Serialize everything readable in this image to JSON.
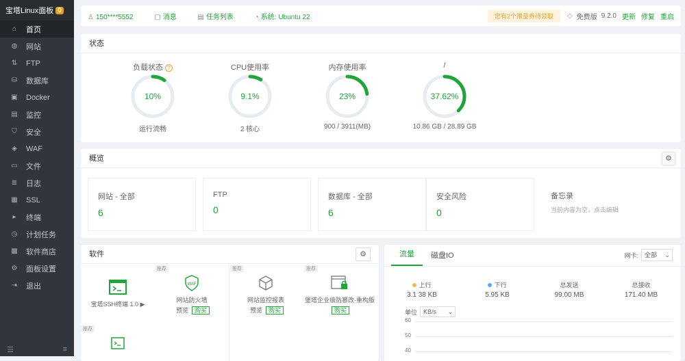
{
  "sidebar": {
    "brand": "宝塔Linux面板",
    "version_badge": "0",
    "items": [
      {
        "icon": "home-icon",
        "glyph": "⌂",
        "label": "首页"
      },
      {
        "icon": "globe-icon",
        "glyph": "◍",
        "label": "网站"
      },
      {
        "icon": "ftp-icon",
        "glyph": "⇅",
        "label": "FTP"
      },
      {
        "icon": "database-icon",
        "glyph": "⛁",
        "label": "数据库"
      },
      {
        "icon": "docker-icon",
        "glyph": "▣",
        "label": "Docker"
      },
      {
        "icon": "monitor-icon",
        "glyph": "▤",
        "label": "监控"
      },
      {
        "icon": "shield-icon",
        "glyph": "⛉",
        "label": "安全"
      },
      {
        "icon": "waf-icon",
        "glyph": "◈",
        "label": "WAF"
      },
      {
        "icon": "folder-icon",
        "glyph": "▭",
        "label": "文件"
      },
      {
        "icon": "log-icon",
        "glyph": "≣",
        "label": "日志"
      },
      {
        "icon": "ssl-icon",
        "glyph": "▦",
        "label": "SSL"
      },
      {
        "icon": "terminal-icon",
        "glyph": "▸",
        "label": "终端"
      },
      {
        "icon": "cron-icon",
        "glyph": "◷",
        "label": "计划任务"
      },
      {
        "icon": "store-icon",
        "glyph": "▩",
        "label": "软件商店"
      },
      {
        "icon": "settings-icon",
        "glyph": "⚙",
        "label": "面板设置"
      },
      {
        "icon": "logout-icon",
        "glyph": "⇥",
        "label": "退出"
      }
    ],
    "active_index": 0
  },
  "topbar": {
    "user": "150****5552",
    "notice": "消息",
    "tasks": "任务列表",
    "system": "系统: Ubuntu 22",
    "promo": "您有2个限量券待领取",
    "edition": "免费版",
    "version": "9.2.0",
    "update": "更新",
    "repair": "修复",
    "restart": "重启"
  },
  "status": {
    "title": "状态",
    "gauges": [
      {
        "label": "负载状态",
        "value": "10%",
        "pct": 10,
        "sub": "运行流畅"
      },
      {
        "label": "CPU使用率",
        "value": "9.1%",
        "pct": 9.1,
        "sub": "2 核心"
      },
      {
        "label": "内存使用率",
        "value": "23%",
        "pct": 23,
        "sub": "900 / 3911(MB)"
      },
      {
        "label": "/",
        "value": "37.62%",
        "pct": 37.62,
        "sub": "10.86 GB / 28.89 GB"
      }
    ]
  },
  "overview": {
    "title": "概览",
    "items": [
      {
        "label": "网站 - 全部",
        "value": "6"
      },
      {
        "label": "FTP",
        "value": "0"
      },
      {
        "label": "数据库 - 全部",
        "value": "6"
      },
      {
        "label": "安全风险",
        "value": "0"
      }
    ],
    "memo_label": "备忘录",
    "memo_hint": "当前内容为空，点击编辑"
  },
  "software": {
    "title": "软件",
    "tag_recommend": "推荐",
    "items": [
      {
        "name": "宝塔SSH终端 1.0 ▶",
        "icon": "terminal-icon"
      },
      {
        "name": "网站防火墙",
        "icon": "waf-shield-icon",
        "act1": "预览",
        "act2": "购买"
      },
      {
        "name": "网站监控报表",
        "icon": "cube-icon",
        "act1": "预览",
        "act2": "购买"
      },
      {
        "name": "堡塔企业级防篡改-重构版",
        "icon": "lock-window-icon",
        "act2": "购买"
      }
    ]
  },
  "traffic": {
    "tabs": [
      "流量",
      "磁盘IO"
    ],
    "iface_label": "网卡:",
    "iface_value": "全部",
    "stats": [
      {
        "key": "上行",
        "value": "3.1 38 KB",
        "color": "#f7b851"
      },
      {
        "key": "下行",
        "value": "5.95 KB",
        "color": "#52a9ff"
      },
      {
        "key": "总发送",
        "value": "99.00 MB"
      },
      {
        "key": "总接收",
        "value": "171.40 MB"
      }
    ],
    "unit_label": "单位",
    "unit_value": "KB/s",
    "y_ticks": [
      "60",
      "50",
      "40"
    ]
  }
}
